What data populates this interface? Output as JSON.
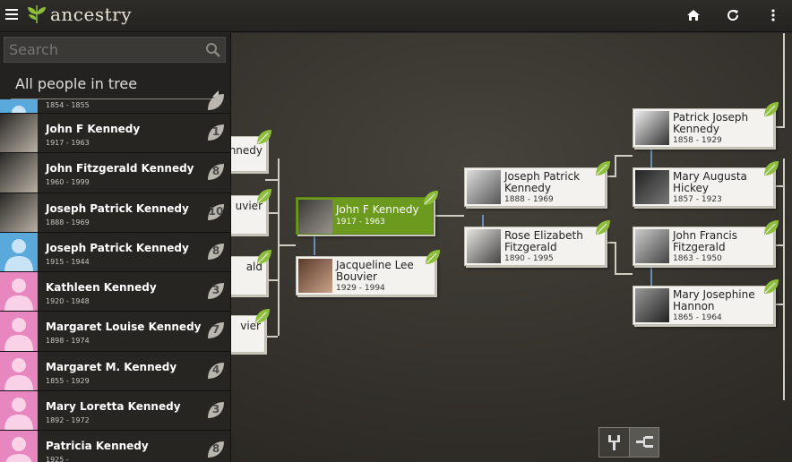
{
  "app": {
    "name": "ancestry"
  },
  "topbar": {
    "icons": [
      "home-icon",
      "refresh-icon",
      "more-vert-icon"
    ]
  },
  "sidebar": {
    "search_placeholder": "Search",
    "filter_label": "All people in tree",
    "people": [
      {
        "name": "",
        "dates": "1854 - 1855",
        "hints": "",
        "avatar": "blue",
        "partial": true
      },
      {
        "name": "John F Kennedy",
        "dates": "1917 - 1963",
        "hints": "1",
        "avatar": "photo"
      },
      {
        "name": "John Fitzgerald Kennedy",
        "dates": "1960 - 1999",
        "hints": "8",
        "avatar": "photo"
      },
      {
        "name": "Joseph Patrick Kennedy",
        "dates": "1888 - 1969",
        "hints": "10",
        "avatar": "photo"
      },
      {
        "name": "Joseph Patrick Kennedy",
        "dates": "1915 - 1944",
        "hints": "8",
        "avatar": "blue"
      },
      {
        "name": "Kathleen Kennedy",
        "dates": "1920 - 1948",
        "hints": "3",
        "avatar": "pink"
      },
      {
        "name": "Margaret Louise Kennedy",
        "dates": "1898 - 1974",
        "hints": "7",
        "avatar": "pink"
      },
      {
        "name": "Margaret M. Kennedy",
        "dates": "1855 - 1929",
        "hints": "4",
        "avatar": "pink"
      },
      {
        "name": "Mary Loretta Kennedy",
        "dates": "1892 - 1972",
        "hints": "3",
        "avatar": "pink"
      },
      {
        "name": "Patricia Kennedy",
        "dates": "1925 -",
        "hints": "8",
        "avatar": "pink"
      }
    ]
  },
  "tree": {
    "stubs": [
      "nnedy",
      "uvier",
      "ald",
      "vier"
    ],
    "focus": {
      "name": "John F Kennedy",
      "dates": "1917 - 1963"
    },
    "spouse": {
      "name": "Jacqueline Lee Bouvier",
      "dates": "1929 - 1994"
    },
    "father": {
      "name": "Joseph Patrick Kennedy",
      "dates": "1888 - 1969"
    },
    "mother": {
      "name": "Rose Elizabeth Fitzgerald",
      "dates": "1890 - 1995"
    },
    "pgf": {
      "name": "Patrick Joseph Kennedy",
      "dates": "1858 - 1929"
    },
    "pgm": {
      "name": "Mary Augusta Hickey",
      "dates": "1857 - 1923"
    },
    "mgf": {
      "name": "John Francis Fitzgerald",
      "dates": "1863 - 1950"
    },
    "mgm": {
      "name": "Mary Josephine Hannon",
      "dates": "1865 - 1964"
    }
  },
  "colors": {
    "focus_card": "#6b9a1f",
    "leaf": "#8dbf3a",
    "male_avatar": "#5aa9dd",
    "female_avatar": "#e887bf"
  }
}
